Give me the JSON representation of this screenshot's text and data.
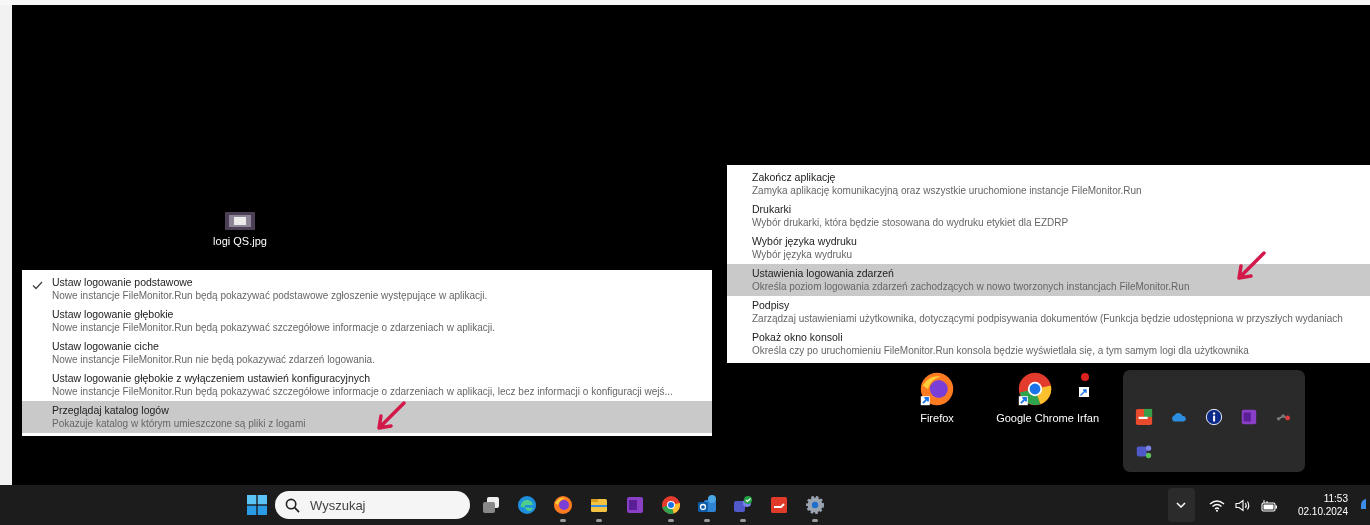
{
  "desktop_icons": [
    {
      "label": "logi QS.jpg",
      "kind": "image"
    },
    {
      "label": "Firefox",
      "kind": "firefox"
    },
    {
      "label": "Google Chrome",
      "kind": "chrome"
    },
    {
      "label": "Irfan",
      "kind": "irfan"
    }
  ],
  "left_menu": {
    "items": [
      {
        "title": "Ustaw logowanie podstawowe",
        "description": "Nowe instancje FileMonitor.Run będą pokazywać podstawowe zgłoszenie występujące w aplikacji.",
        "checked": true,
        "selected": false
      },
      {
        "title": "Ustaw logowanie głębokie",
        "description": "Nowe instancje FileMonitor.Run będą pokazywać szczegółowe informacje o zdarzeniach w aplikacji.",
        "checked": false,
        "selected": false
      },
      {
        "title": "Ustaw logowanie ciche",
        "description": "Nowe instancje FileMonitor.Run nie będą pokazywać zdarzeń logowania.",
        "checked": false,
        "selected": false
      },
      {
        "title": "Ustaw logowanie głębokie z wyłączeniem ustawień konfiguracyjnych",
        "description": "Nowe instancje FileMonitor.Run będą pokazywać szczegółowe informacje o zdarzeniach w aplikacji, lecz bez informacji o konfiguracji wejś...",
        "checked": false,
        "selected": false
      },
      {
        "title": "Przeglądaj katalog logów",
        "description": "Pokazuje katalog w którym umieszczone są pliki z logami",
        "checked": false,
        "selected": true
      }
    ]
  },
  "right_menu": {
    "items": [
      {
        "title": "Zakończ aplikację",
        "description": "Zamyka aplikację komunikacyjną oraz wszystkie uruchomione instancje FileMonitor.Run",
        "selected": false
      },
      {
        "title": "Drukarki",
        "description": "Wybór drukarki, która będzie stosowana do wydruku etykiet dla EZDRP",
        "selected": false
      },
      {
        "title": "Wybór języka wydruku",
        "description": "Wybór języka wydruku",
        "selected": false
      },
      {
        "title": "Ustawienia logowania zdarzeń",
        "description": "Określa poziom logowania zdarzeń zachodzących w nowo tworzonych instancjach FileMonitor.Run",
        "selected": true
      },
      {
        "title": "Podpisy",
        "description": "Zarządzaj ustawieniami użytkownika, dotyczącymi podpisywania dokumentów (Funkcja będzie udostępniona w przyszłych wydaniach",
        "selected": false
      },
      {
        "title": "Pokaż okno konsoli",
        "description": "Określa czy po uruchomieniu FileMonitor.Run konsola będzie wyświetlała się, a tym samym logi dla użytkownika",
        "selected": false
      }
    ]
  },
  "tray_popup": {
    "icons": [
      {
        "kind": "key"
      },
      {
        "kind": "cloud"
      },
      {
        "kind": "info"
      },
      {
        "kind": "onenote"
      },
      {
        "kind": "dots"
      },
      {
        "kind": "teams"
      }
    ]
  },
  "taskbar": {
    "search": {
      "placeholder": "Wyszukaj"
    },
    "apps": [
      {
        "kind": "taskview",
        "running": false
      },
      {
        "kind": "edge",
        "running": false
      },
      {
        "kind": "firefox",
        "running": true
      },
      {
        "kind": "explorer",
        "running": true
      },
      {
        "kind": "onenote",
        "running": false
      },
      {
        "kind": "chrome",
        "running": true
      },
      {
        "kind": "outlook",
        "running": true
      },
      {
        "kind": "teams",
        "running": true
      },
      {
        "kind": "redapp",
        "running": false
      },
      {
        "kind": "settings",
        "running": true
      }
    ],
    "time": "11:53",
    "date": "02.10.2024"
  }
}
